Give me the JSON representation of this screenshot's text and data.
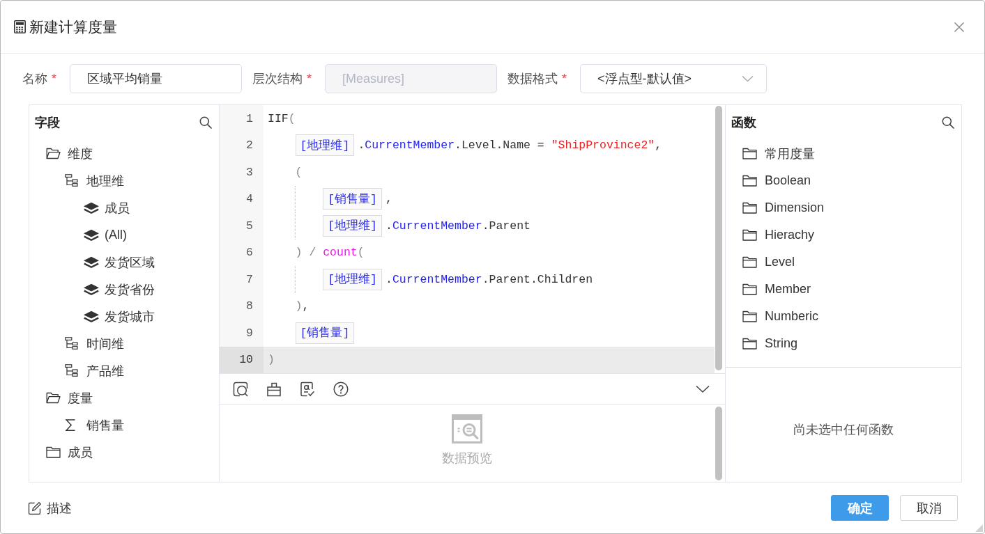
{
  "window": {
    "title": "新建计算度量"
  },
  "form": {
    "fields": [
      {
        "label": "名称",
        "required_mark": "*",
        "kind": "input",
        "value": "区域平均销量",
        "disabled": false
      },
      {
        "label": "层次结构",
        "required_mark": "*",
        "kind": "input",
        "value": "[Measures]",
        "disabled": true
      },
      {
        "label": "数据格式",
        "required_mark": "*",
        "kind": "select",
        "value": "<浮点型-默认值>",
        "disabled": false
      }
    ]
  },
  "fields_panel": {
    "title": "字段",
    "tree": [
      {
        "label": "维度",
        "kind": "folder",
        "expanded": true,
        "children": [
          {
            "label": "地理维",
            "kind": "hierarchy",
            "children": [
              {
                "label": "成员",
                "kind": "level"
              },
              {
                "label": "(All)",
                "kind": "level"
              },
              {
                "label": "发货区域",
                "kind": "level"
              },
              {
                "label": "发货省份",
                "kind": "level"
              },
              {
                "label": "发货城市",
                "kind": "level"
              }
            ]
          },
          {
            "label": "时间维",
            "kind": "hierarchy"
          },
          {
            "label": "产品维",
            "kind": "hierarchy"
          }
        ]
      },
      {
        "label": "度量",
        "kind": "folder",
        "expanded": true,
        "children": [
          {
            "label": "销售量",
            "kind": "measure"
          }
        ]
      },
      {
        "label": "成员",
        "kind": "folder",
        "expanded": false
      }
    ]
  },
  "editor": {
    "lines": [
      {
        "number": "1",
        "active": false,
        "tokens": [
          {
            "kind": "plain",
            "text": "IIF"
          },
          {
            "kind": "punct",
            "text": "("
          }
        ],
        "children": [
          {
            "number": "2",
            "active": false,
            "tokens": [
              {
                "kind": "field",
                "text": "[地理维]"
              },
              {
                "kind": "plain",
                "text": "."
              },
              {
                "kind": "member",
                "text": "CurrentMember"
              },
              {
                "kind": "plain",
                "text": ".Level.Name = "
              },
              {
                "kind": "string",
                "text": "\"ShipProvince2\""
              },
              {
                "kind": "plain",
                "text": ","
              }
            ]
          },
          {
            "number": "3",
            "active": false,
            "tokens": [
              {
                "kind": "punct",
                "text": "("
              }
            ],
            "children": [
              {
                "number": "4",
                "active": false,
                "tokens": [
                  {
                    "kind": "field",
                    "text": "[销售量]"
                  },
                  {
                    "kind": "plain",
                    "text": ","
                  }
                ]
              },
              {
                "number": "5",
                "active": false,
                "tokens": [
                  {
                    "kind": "field",
                    "text": "[地理维]"
                  },
                  {
                    "kind": "plain",
                    "text": "."
                  },
                  {
                    "kind": "member",
                    "text": "CurrentMember"
                  },
                  {
                    "kind": "plain",
                    "text": ".Parent"
                  }
                ]
              }
            ]
          },
          {
            "number": "6",
            "active": false,
            "tokens": [
              {
                "kind": "punct",
                "text": ") / "
              },
              {
                "kind": "function",
                "text": "count"
              },
              {
                "kind": "punct",
                "text": "("
              }
            ],
            "children": [
              {
                "number": "7",
                "active": false,
                "tokens": [
                  {
                    "kind": "field",
                    "text": "[地理维]"
                  },
                  {
                    "kind": "plain",
                    "text": "."
                  },
                  {
                    "kind": "member",
                    "text": "CurrentMember"
                  },
                  {
                    "kind": "plain",
                    "text": ".Parent.Children"
                  }
                ]
              }
            ]
          },
          {
            "number": "8",
            "active": false,
            "tokens": [
              {
                "kind": "punct",
                "text": ")"
              },
              {
                "kind": "plain",
                "text": ","
              }
            ]
          },
          {
            "number": "9",
            "active": false,
            "tokens": [
              {
                "kind": "field",
                "text": "[销售量]"
              }
            ]
          }
        ]
      },
      {
        "number": "10",
        "active": true,
        "tokens": [
          {
            "kind": "punct",
            "text": ")"
          }
        ]
      }
    ],
    "preview": {
      "label": "数据预览"
    }
  },
  "functions_panel": {
    "title": "函数",
    "items": [
      {
        "label": "常用度量"
      },
      {
        "label": "Boolean"
      },
      {
        "label": "Dimension"
      },
      {
        "label": "Hierachy"
      },
      {
        "label": "Level"
      },
      {
        "label": "Member"
      },
      {
        "label": "Numberic"
      },
      {
        "label": "String"
      }
    ],
    "detail_placeholder": "尚未选中任何函数"
  },
  "footer": {
    "description": {
      "label": "描述"
    },
    "buttons": [
      {
        "label": "确定",
        "kind": "primary"
      },
      {
        "label": "取消",
        "kind": "secondary"
      }
    ]
  }
}
